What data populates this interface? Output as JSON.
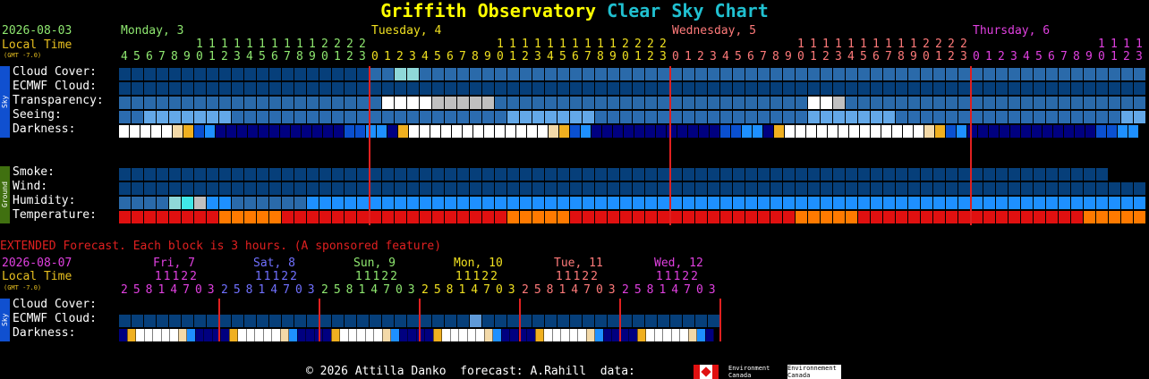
{
  "header": {
    "title_location": "Griffith Observatory",
    "title_suffix": "Clear Sky Chart",
    "date": "2026-08-03",
    "local_time_label": "Local Time",
    "gmt": "(GMT -7.0)"
  },
  "days": [
    {
      "label": "Monday, 3",
      "color": "#8fe870"
    },
    {
      "label": "Tuesday, 4",
      "color": "#f0e020"
    },
    {
      "label": "Wednesday, 5",
      "color": "#ff7a7a"
    },
    {
      "label": "Thursday, 6",
      "color": "#e040e0"
    }
  ],
  "hours_start": 4,
  "hours_count": 92,
  "midnight_indices": [
    20,
    44,
    68,
    92
  ],
  "side_labels": {
    "sky": "Sky",
    "ground": "Ground"
  },
  "row_labels": {
    "cloud": "Cloud Cover:",
    "ecmwf": "ECMWF Cloud:",
    "transparency": "Transparency:",
    "seeing": "Seeing:",
    "darkness": "Darkness:",
    "smoke": "Smoke:",
    "wind": "Wind:",
    "humidity": "Humidity:",
    "temperature": "Temperature:"
  },
  "colors": {
    "background": "#000000",
    "clear_block": "#063f7a",
    "separator": "#e02020"
  },
  "chart_data": [
    {
      "type": "heatmap",
      "title": "Clear Sky Chart",
      "x_unit": "hour (local)",
      "rows": [
        {
          "name": "Cloud Cover",
          "cells": "ccccccccccccccccccccCCaaCCCCCCCCCCCCCCCCCCCCCCCCCCCCCCCCCCCCCCCCCCCCCCCCCCCCCCCCCCCCCCCCCCCCCCCCC"
        },
        {
          "name": "ECMWF Cloud",
          "cells": "cccccccccccccccccccccccccccccccccccccccccccccccccccccccccccccccccccccccccccccccccccccccccccccccc"
        },
        {
          "name": "Transparency",
          "cells": "CCCCCCCCCCCCCCCCCCCCCwwwwgggggCCCCCCCCCCCCCCCCCCCCCCCCCwwgCCCCCCCCCCCCCCCCCCCCCCCCCCCCCwawwwCCCCC"
        },
        {
          "name": "Seeing",
          "cells": "SSTTTTTTTSSSSSSSSSSSSSSSSSSSSSSTTTTTTTSSSSSSSSSSSSSSSSSTTTTTTTSSSSSSSSSSSSSSSSSSTTTTTTTSSSSSSSSSS"
        },
        {
          "name": "Darkness",
          "cells": "WWWWWHYDBNNNNNNNNNNNNDDBBNYWWWWWWWWWWWWWHYDBNNNNNNNNNNNNDDBBNYWWWWWWWWWWWWWHYDBNNNNNNNNNNNNDDBBNYWWWWWWWWWWWWWHYDBNNN"
        },
        {
          "name": "Smoke",
          "cells": "ccccccccccccccccccccccccccccccccccccccccccccccccccccccccccccccccccccccccccccccc"
        },
        {
          "name": "Wind",
          "cells": "ccccccccccccccccccccccccccccccccccccccccccccccccccccccccccccccccccccccccccccccccccccccccCCCCCCCC"
        },
        {
          "name": "Humidity",
          "cells": "CCCCaLgBBCCCCCCBBBBBBBBBBBBBBBBBBBBBBBBBBBBBBBBBBBBBBBBBBBBBBBBBBBBBBBBBBBBBBBBBBBBBBBBBBBBBBBB"
        },
        {
          "name": "Temperature",
          "cells": "RRRRRRRROOOOORRRRRRRRRRRRRRRRRROOOOORRRRRRRRRRRRRRRRRROOOOORRRRRRRRRRRRRRRRRROOOOORRRRRRRRRRRRR"
        }
      ]
    },
    {
      "type": "heatmap",
      "title": "EXTENDED Forecast. Each block is 3 hours. (A sponsored feature)",
      "x_unit": "3-hour block (local)",
      "rows": [
        {
          "name": "Cloud Cover",
          "cells": ""
        },
        {
          "name": "ECMWF Cloud",
          "cells": "cccccccccccccccccccccccccccccccccccccccccccccccc"
        },
        {
          "name": "Darkness",
          "cells": "NYWWWWWHBNNNNYWWWWWHBNNNNYWWWWWHBNNNNYWWWWWHBNNNNYWWWWWHBNNNNYWWWWWHBN"
        }
      ]
    }
  ],
  "extended": {
    "heading": "EXTENDED Forecast. Each block is 3 hours. (A sponsored feature)",
    "date": "2026-08-07",
    "local_time_label": "Local Time",
    "gmt": "(GMT -7.0)",
    "days": [
      {
        "label": "Fri, 7",
        "color": "#e040e0",
        "hours_hi": " 11122",
        "hours_lo": "25814703"
      },
      {
        "label": "Sat, 8",
        "color": "#7070ff",
        "hours_hi": " 11122",
        "hours_lo": "25814703"
      },
      {
        "label": "Sun, 9",
        "color": "#8fe870",
        "hours_hi": " 11122",
        "hours_lo": "25814703"
      },
      {
        "label": "Mon, 10",
        "color": "#f0e020",
        "hours_hi": " 11122",
        "hours_lo": "25814703"
      },
      {
        "label": "Tue, 11",
        "color": "#ff7a7a",
        "hours_hi": " 11122",
        "hours_lo": "25814703"
      },
      {
        "label": "Wed, 12",
        "color": "#e040e0",
        "hours_hi": " 11122",
        "hours_lo": "25814703"
      }
    ],
    "row_labels": {
      "cloud": "Cloud Cover:",
      "ecmwf": "ECMWF Cloud:",
      "darkness": "Darkness:"
    }
  },
  "footer": {
    "credits": "© 2026 Attilla Danko  forecast: A.Rahill  data:",
    "logo_text": "Environment\nCanada",
    "logo_text_fr": "Environnement\nCanada"
  }
}
